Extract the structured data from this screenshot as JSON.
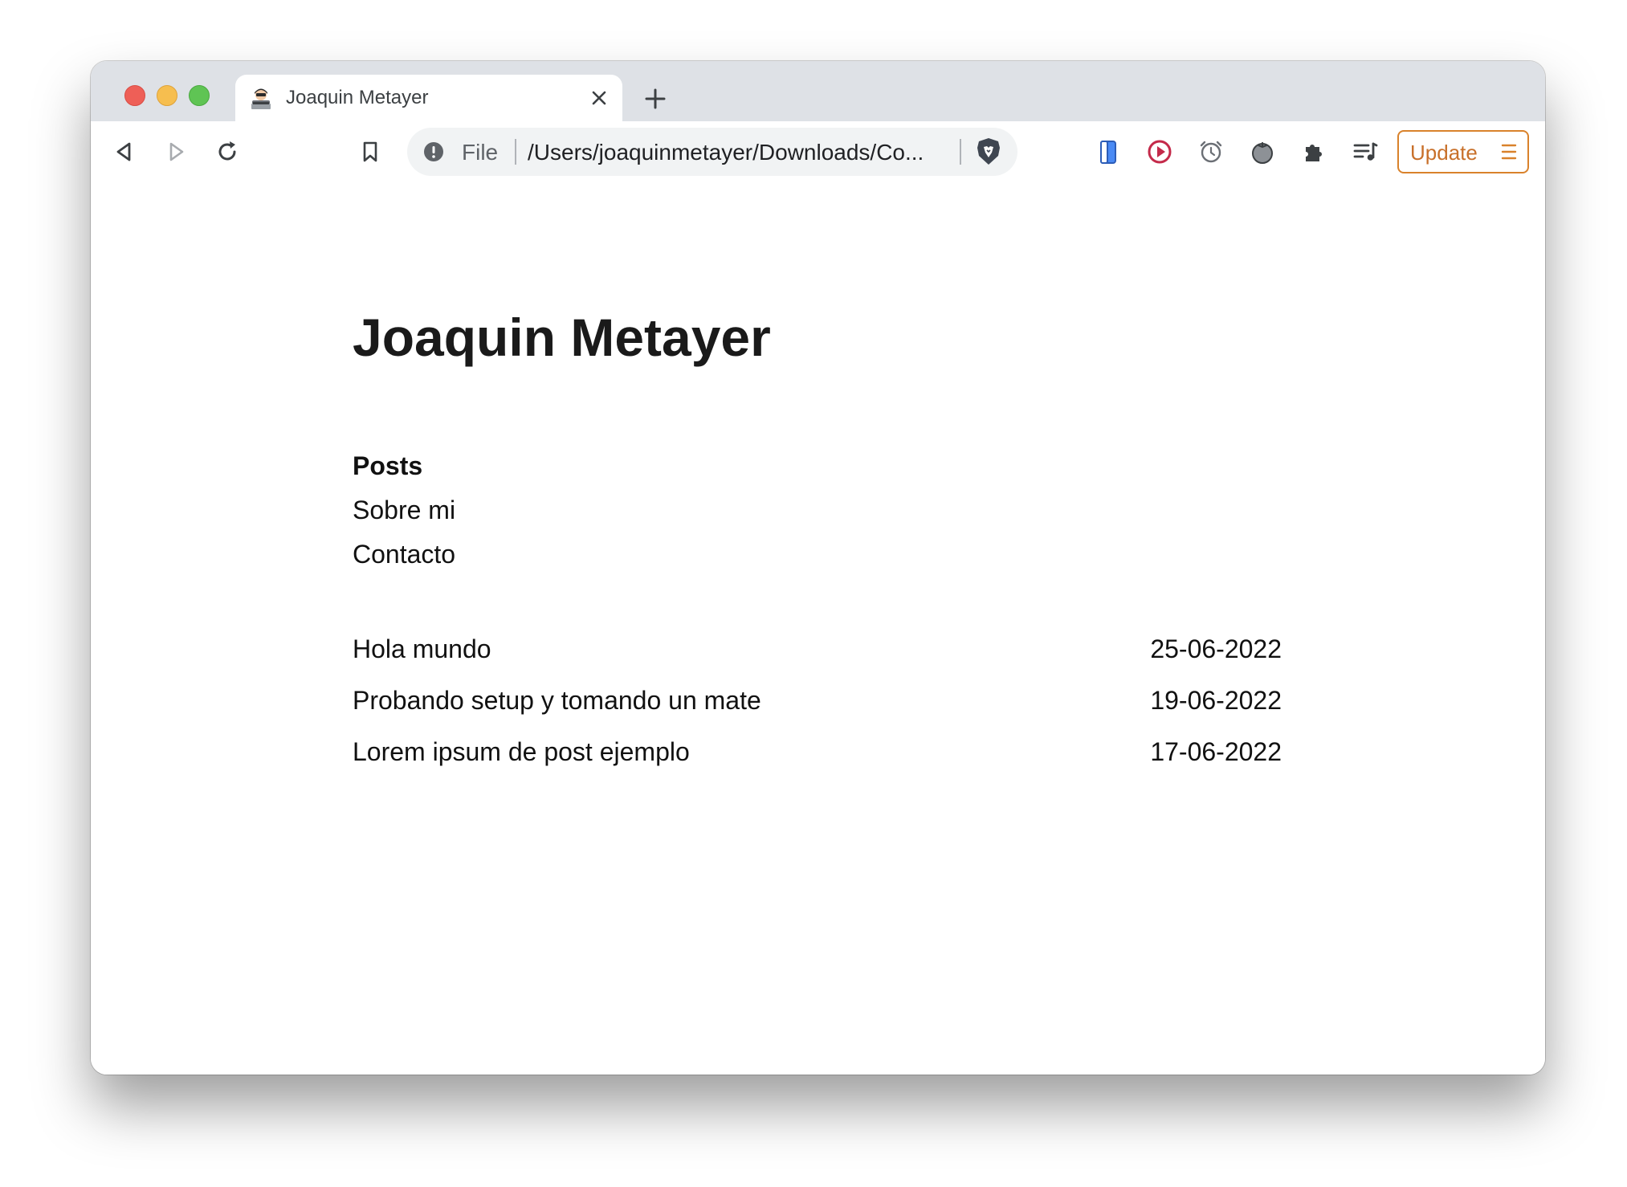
{
  "browser": {
    "tab": {
      "title": "Joaquin Metayer",
      "favicon": "hacker-emoji-icon"
    },
    "omnibox": {
      "scheme_label": "File",
      "url": "/Users/joaquinmetayer/Downloads/Co...",
      "security_icon": "info-icon"
    },
    "toolbar_icons": [
      "back-icon",
      "forward-icon",
      "reload-icon",
      "bookmark-icon",
      "brave-shield-icon",
      "phone-extension-icon",
      "play-extension-icon",
      "alarm-extension-icon",
      "tomato-extension-icon",
      "extensions-puzzle-icon",
      "media-queue-icon"
    ],
    "update_button": {
      "label": "Update",
      "color": "#d9822b"
    }
  },
  "site": {
    "title": "Joaquin Metayer",
    "nav": [
      {
        "label": "Posts",
        "active": true
      },
      {
        "label": "Sobre mi",
        "active": false
      },
      {
        "label": "Contacto",
        "active": false
      }
    ],
    "posts": [
      {
        "title": "Hola mundo",
        "date": "25-06-2022"
      },
      {
        "title": "Probando setup y tomando un mate",
        "date": "19-06-2022"
      },
      {
        "title": "Lorem ipsum de post ejemplo",
        "date": "17-06-2022"
      }
    ]
  }
}
